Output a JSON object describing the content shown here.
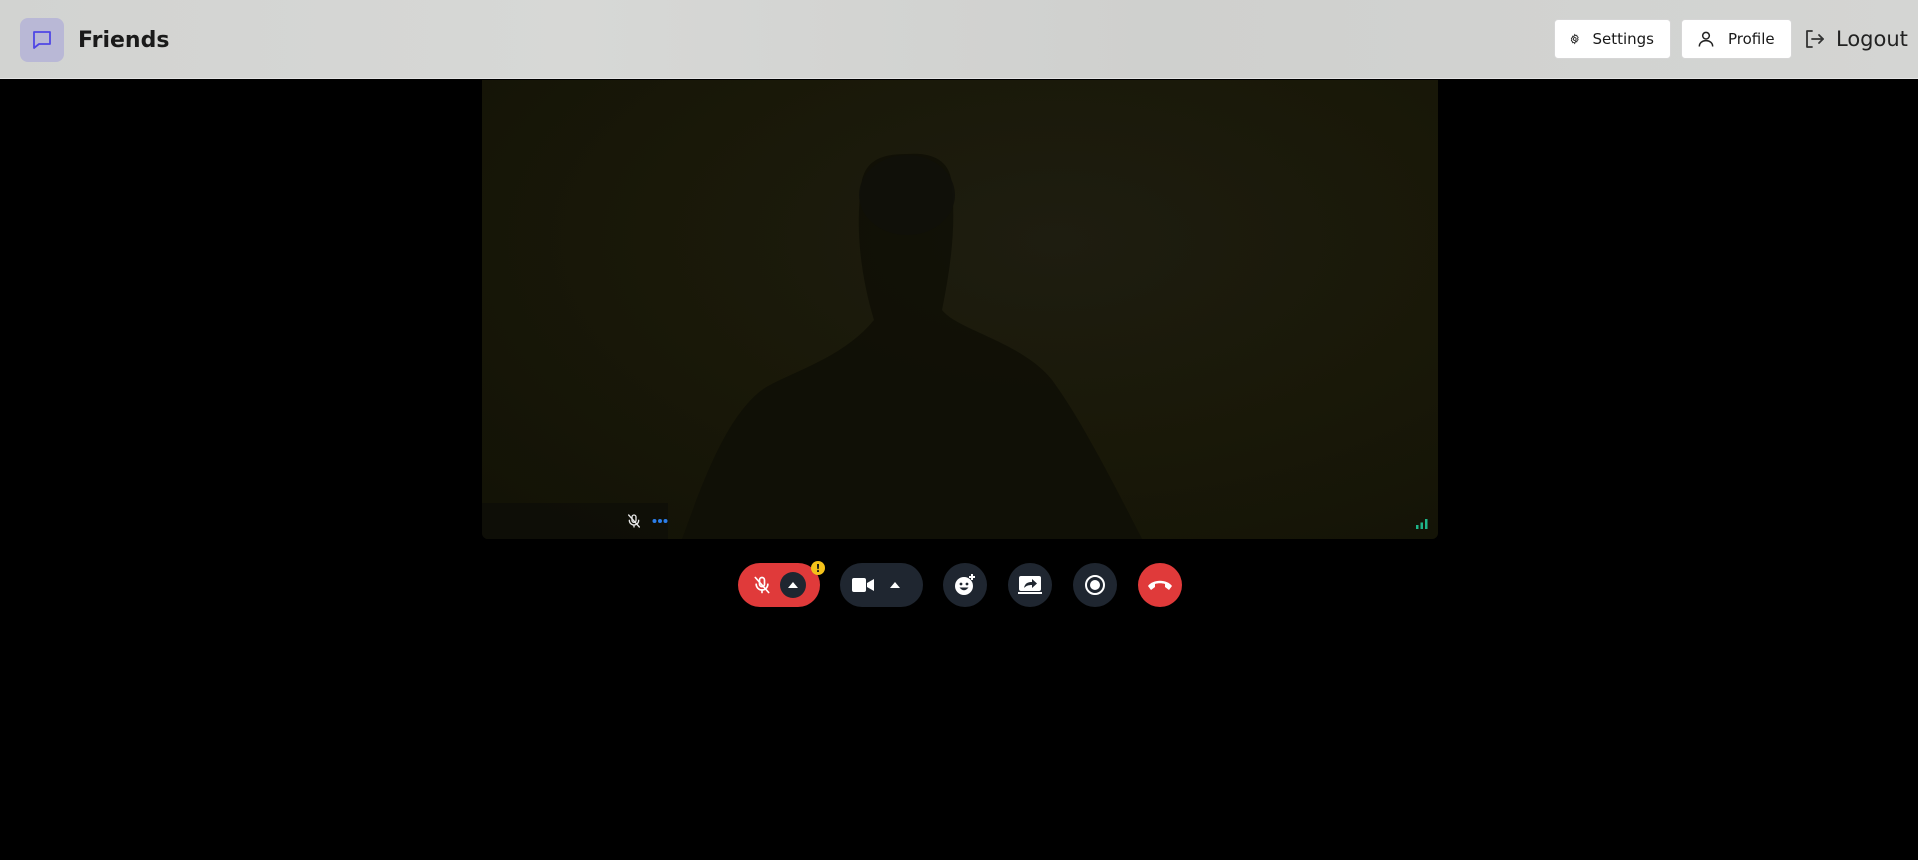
{
  "app": {
    "title": "Friends",
    "logo_icon": "chat-bubble-icon"
  },
  "header": {
    "settings_label": "Settings",
    "profile_label": "Profile",
    "logout_label": "Logout"
  },
  "video": {
    "participant_name": "",
    "mic_state": "muted",
    "connection_quality": "good"
  },
  "controls": {
    "mic": {
      "state": "muted",
      "warning_badge": "!"
    },
    "camera": {
      "state": "on"
    },
    "buttons": [
      "reactions",
      "share-screen",
      "record",
      "hang-up"
    ]
  },
  "colors": {
    "accent_red": "#e03a3a",
    "control_dark": "#1f2630",
    "warning": "#f4c21a",
    "brand_purple": "#4f46e5",
    "signal_green": "#1fb589"
  }
}
